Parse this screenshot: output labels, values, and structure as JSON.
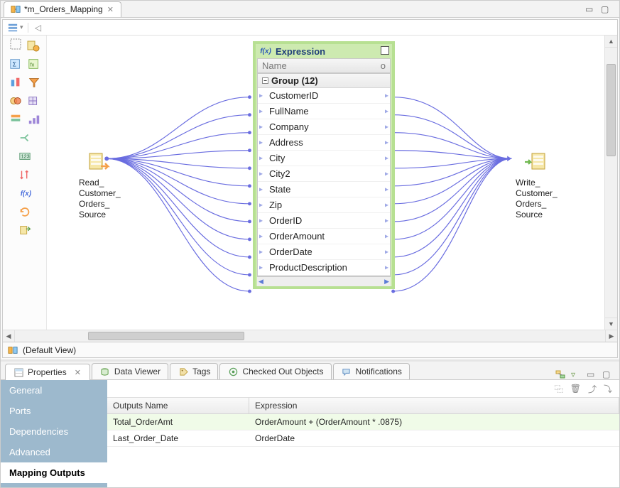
{
  "tab": {
    "title": "*m_Orders_Mapping",
    "close_glyph": "✕"
  },
  "window_controls": {
    "minimize": "▭",
    "maximize": "▢"
  },
  "toolbar": {
    "tool_a": "▥",
    "tool_sep": "",
    "arrow_left": "◁"
  },
  "palette_icons": [
    [
      "home-icon",
      "#f5a04a",
      "source-read-icon",
      "#f5a04a"
    ],
    [
      "transform-icon",
      "#7ac29a",
      "expression-icon",
      "#f6b34b"
    ],
    [
      "lookup-icon",
      "#5ba0e0",
      "mapping-icon",
      "#f5a04a"
    ],
    [
      "aggregator-icon",
      "#f06a6a",
      "filter-icon",
      "#f5a04a"
    ],
    [
      "joiner-icon",
      "#f5a04a",
      "joiner2-icon",
      "#9e86d8"
    ],
    [
      "normalizer-icon",
      "#7ac29a",
      null,
      null
    ],
    [
      "rank-icon",
      "#7ac29a",
      null,
      null
    ],
    [
      "router-icon",
      "#f06a6a",
      null,
      null
    ],
    [
      "sequence-icon",
      "#5ba0e0",
      null,
      null
    ],
    [
      "sorter-icon",
      "#f5a04a",
      null,
      null
    ],
    [
      "transaction-icon",
      "#f5a04a",
      null,
      null
    ]
  ],
  "nodes": {
    "source": {
      "label": "Read_\nCustomer_\nOrders_\nSource"
    },
    "target": {
      "label": "Write_\nCustomer_\nOrders_\nSource"
    }
  },
  "expression": {
    "title": "Expression",
    "header_col": "Name",
    "header_ind": "o",
    "group_label": "Group (12)",
    "fields": [
      "CustomerID",
      "FullName",
      "Company",
      "Address",
      "City",
      "City2",
      "State",
      "Zip",
      "OrderID",
      "OrderAmount",
      "OrderDate",
      "ProductDescription"
    ],
    "hscroll_left": "◀",
    "hscroll_right": "▶"
  },
  "view_bar": {
    "label": "(Default View)"
  },
  "bottom_tabs": {
    "properties": "Properties",
    "data_viewer": "Data Viewer",
    "tags": "Tags",
    "checked_out": "Checked Out Objects",
    "notifications": "Notifications"
  },
  "properties_side": {
    "general": "General",
    "ports": "Ports",
    "dependencies": "Dependencies",
    "advanced": "Advanced",
    "mapping_outputs": "Mapping Outputs"
  },
  "properties_table": {
    "columns": {
      "name": "Outputs Name",
      "expr": "Expression"
    },
    "rows": [
      {
        "name": "Total_OrderAmt",
        "expr": "OrderAmount + (OrderAmount * .0875)",
        "highlight": true
      },
      {
        "name": "Last_Order_Date",
        "expr": "OrderDate",
        "highlight": false
      }
    ]
  },
  "icons": {
    "fx": "f(x)",
    "tag": "⌂",
    "eye": "◉",
    "msg_bubble": "💬",
    "copy": "⿻",
    "trash": "🗑",
    "export": "⤴",
    "import": "⤵",
    "gear": "⚙",
    "down": "▿",
    "min2": "▭",
    "max2": "▢",
    "db": "≣"
  }
}
